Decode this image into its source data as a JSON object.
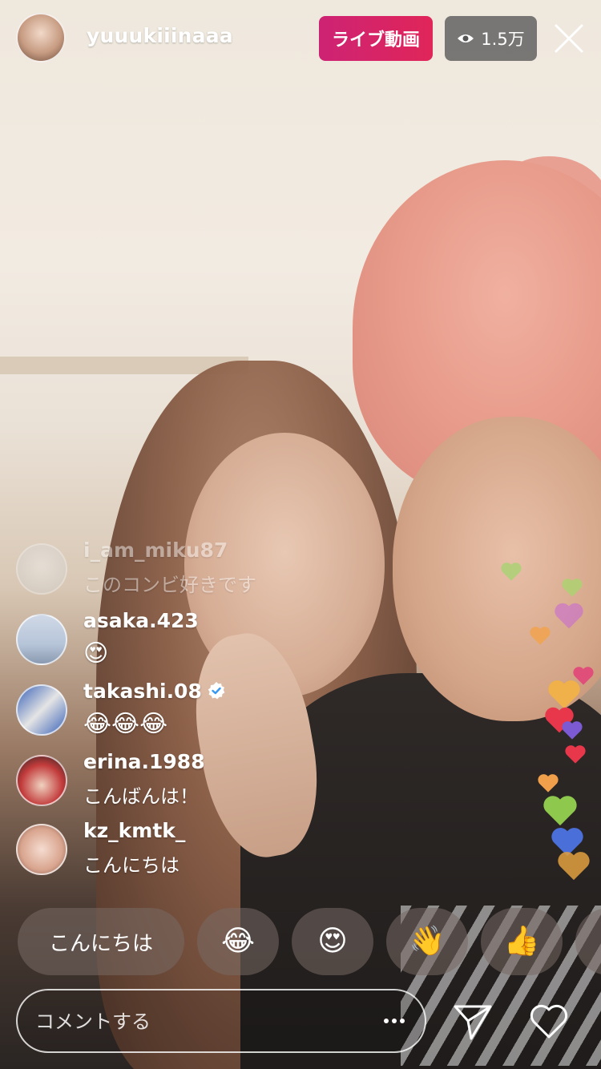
{
  "header": {
    "username": "yuuukiiinaaa",
    "live_label": "ライブ動画",
    "viewer_count": "1.5万",
    "live_color": "#d82468"
  },
  "comments": [
    {
      "user": "i_am_miku87",
      "text": "このコンビ好きです",
      "faded": true
    },
    {
      "user": "asaka.423",
      "text": "😍",
      "faded": false
    },
    {
      "user": "takashi.08",
      "text": "😂😂😂",
      "verified": true,
      "faded": false
    },
    {
      "user": "erina.1988",
      "text": "こんばんは！",
      "faded": false
    },
    {
      "user": "kz_kmtk_",
      "text": "こんにちは",
      "faded": false
    }
  ],
  "quick_replies": [
    {
      "label": "こんにちは",
      "type": "text"
    },
    {
      "label": "😂",
      "type": "emoji"
    },
    {
      "label": "😍",
      "type": "emoji"
    },
    {
      "label": "👋",
      "type": "emoji"
    },
    {
      "label": "👍",
      "type": "emoji"
    }
  ],
  "input": {
    "placeholder": "コメントする"
  },
  "icons": {
    "eye": "eye-icon",
    "close": "close-icon",
    "send": "paper-plane-icon",
    "like": "heart-icon",
    "more": "more-dots-icon",
    "verified": "verified-badge-icon"
  }
}
